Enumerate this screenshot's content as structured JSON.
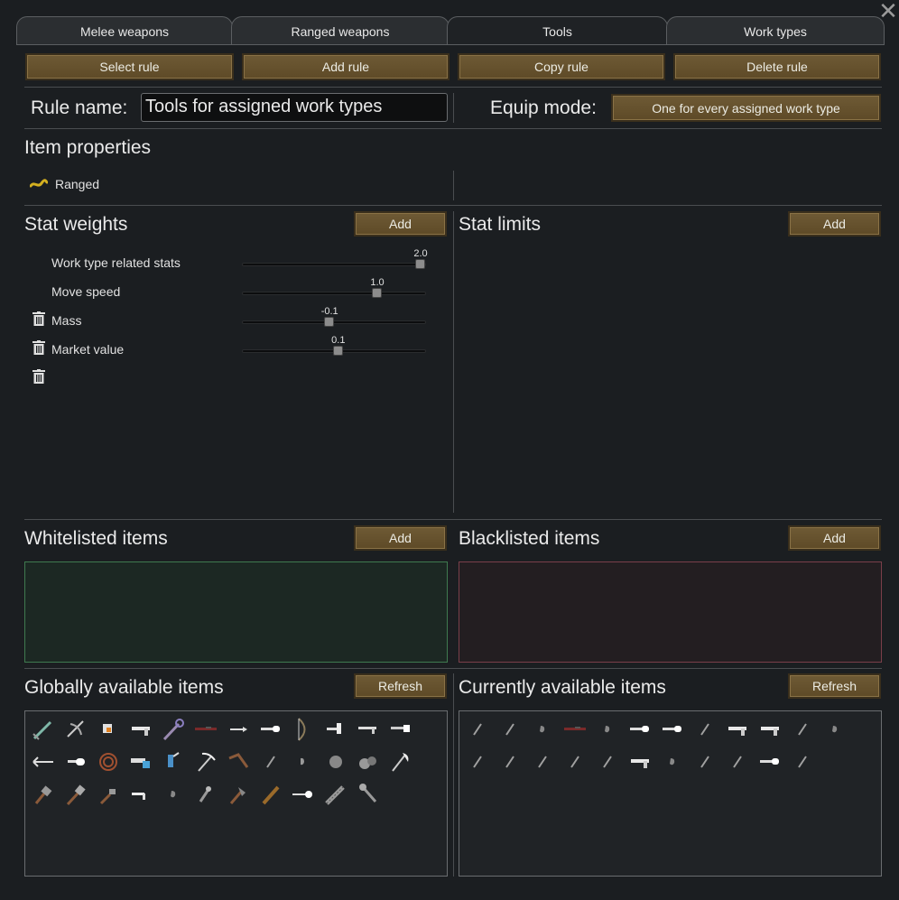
{
  "tabs": [
    "Melee weapons",
    "Ranged weapons",
    "Tools",
    "Work types"
  ],
  "active_tab": "Tools",
  "toolbar": {
    "select_rule": "Select rule",
    "add_rule": "Add rule",
    "copy_rule": "Copy rule",
    "delete_rule": "Delete rule"
  },
  "rule": {
    "name_label": "Rule name:",
    "name_value": "Tools for assigned work types",
    "equip_mode_label": "Equip mode:",
    "equip_mode_value": "One for every assigned work type"
  },
  "item_properties": {
    "title": "Item properties",
    "entries": [
      {
        "label": "Ranged",
        "icon": "ranged-icon",
        "color": "#d4b020"
      }
    ]
  },
  "stat_weights": {
    "title": "Stat weights",
    "add_label": "Add",
    "stats": [
      {
        "label": "Work type related stats",
        "value_text": "2.0",
        "fraction": 1.0,
        "deletable": false
      },
      {
        "label": "Move speed",
        "value_text": "1.0",
        "fraction": 0.75,
        "deletable": true
      },
      {
        "label": "Mass",
        "value_text": "-0.1",
        "fraction": 0.475,
        "deletable": true
      },
      {
        "label": "Market value",
        "value_text": "0.1",
        "fraction": 0.525,
        "deletable": true
      }
    ]
  },
  "stat_limits": {
    "title": "Stat limits",
    "add_label": "Add"
  },
  "whitelist": {
    "title": "Whitelisted items",
    "add_label": "Add",
    "border_color": "#3f7a4f",
    "bg": "#1c2823"
  },
  "blacklist": {
    "title": "Blacklisted items",
    "add_label": "Add",
    "border_color": "#7a3f4a",
    "bg": "#231e21"
  },
  "global_items": {
    "title": "Globally available items",
    "refresh_label": "Refresh",
    "icons": [
      "sword-icon",
      "crossbow-icon",
      "drill-icon",
      "pistol-icon",
      "staff-icon",
      "rifle-icon",
      "dart-icon",
      "shotgun-icon",
      "bow-icon",
      "hammer-gun-icon",
      "smg-icon",
      "launcher-icon",
      "pick-arrow-icon",
      "gun-icon",
      "whip-icon",
      "blaster-icon",
      "blue-tool-icon",
      "pickaxe-icon",
      "boomerang-icon",
      "knife-icon",
      "stone-icon",
      "ball-icon",
      "rock-pile-icon",
      "axe-icon",
      "mallet-icon",
      "warhammer-icon",
      "sledge-icon",
      "revolver-icon",
      "pebble-icon",
      "wrench-icon",
      "hatchet-icon",
      "club-icon",
      "spear-gun-icon",
      "chainsaw-icon",
      "wrench-large-icon"
    ]
  },
  "current_items": {
    "title": "Currently available items",
    "refresh_label": "Refresh",
    "icons": [
      "knife-icon",
      "knife-icon",
      "pebble-icon",
      "rifle-icon",
      "pebble-icon",
      "shotgun-icon",
      "shotgun-icon",
      "knife-icon",
      "pistol-icon",
      "pistol-icon",
      "knife-icon",
      "pebble-icon",
      "knife-icon",
      "knife-icon",
      "knife-icon",
      "knife-icon",
      "knife-icon",
      "pistol-icon",
      "pebble-icon",
      "knife-icon",
      "knife-icon",
      "shotgun-icon",
      "knife-icon"
    ]
  }
}
